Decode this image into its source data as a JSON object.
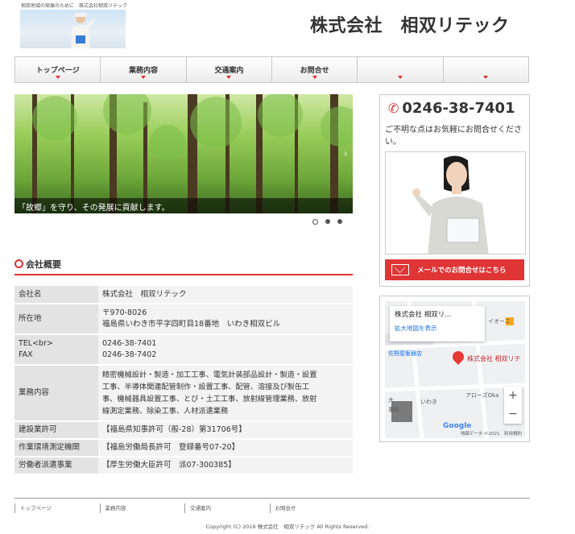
{
  "header": {
    "tagline": "相双地域の発展のために　株式会社相双リテック",
    "company_name": "株式会社　相双リテック"
  },
  "nav": {
    "items": [
      {
        "label": "トップページ"
      },
      {
        "label": "業務内容"
      },
      {
        "label": "交通案内"
      },
      {
        "label": "お問合せ"
      },
      {
        "label": ""
      },
      {
        "label": ""
      }
    ]
  },
  "slider": {
    "caption": "「故郷」を守り、その発展に貢献します。",
    "dot_count": 3,
    "active_dot": 0
  },
  "company_section": {
    "heading": "会社概要",
    "rows": [
      {
        "key": "会社名",
        "value": [
          "株式会社　相双リテック"
        ]
      },
      {
        "key": "所在地",
        "value": [
          "〒970-8026",
          "福島県いわき市平字四町目18番地　いわき相双ビル"
        ]
      },
      {
        "key": "TEL<br>\nFAX",
        "value": [
          "0246-38-7401",
          "0246-38-7402"
        ]
      },
      {
        "key": "業務内容",
        "value": [
          "精密機械設計・製造・加工工事、電気計装部品設計・製造・設置",
          "工事、半導体関連配管制作・設置工事、配管、溶接及び製缶工",
          "事、機械器具設置工事、とび・土工工事、放射線管理業務、放射",
          "線測定業務、除染工事、人材派遣業務"
        ]
      },
      {
        "key": "建設業許可",
        "value": [
          "【福島県知事許可（般-28）第31706号】"
        ]
      },
      {
        "key": "作業環境測定機関",
        "value": [
          "【福島労働局長許可　登録番号07-20】"
        ]
      },
      {
        "key": "労働者派遣事業",
        "value": [
          "【厚生労働大臣許可　派07-300385】"
        ]
      }
    ]
  },
  "contact": {
    "phone": "0246-38-7401",
    "note": "ご不明な点はお気軽にお問合せください。",
    "mail_button": "メールでのお問合せはこちら"
  },
  "map": {
    "place_name": "株式会社 相双リ...",
    "enlarge_link": "拡大地図を表示",
    "pin_label": "株式会社 相双リテ",
    "labels": [
      "佐野屋衡器店",
      "イオーエ",
      "アローズOka",
      "いわき",
      "事所",
      "大"
    ],
    "zoom_in": "+",
    "zoom_out": "−",
    "brand": "Google",
    "credit": "地図データ ©2021　利用規約"
  },
  "footer": {
    "links": [
      "トップページ",
      "業務内容",
      "交通案内",
      "お問合せ"
    ],
    "copyright": "Copyright (C) 2018 株式会社　相双リテック All Rights Reserved."
  }
}
